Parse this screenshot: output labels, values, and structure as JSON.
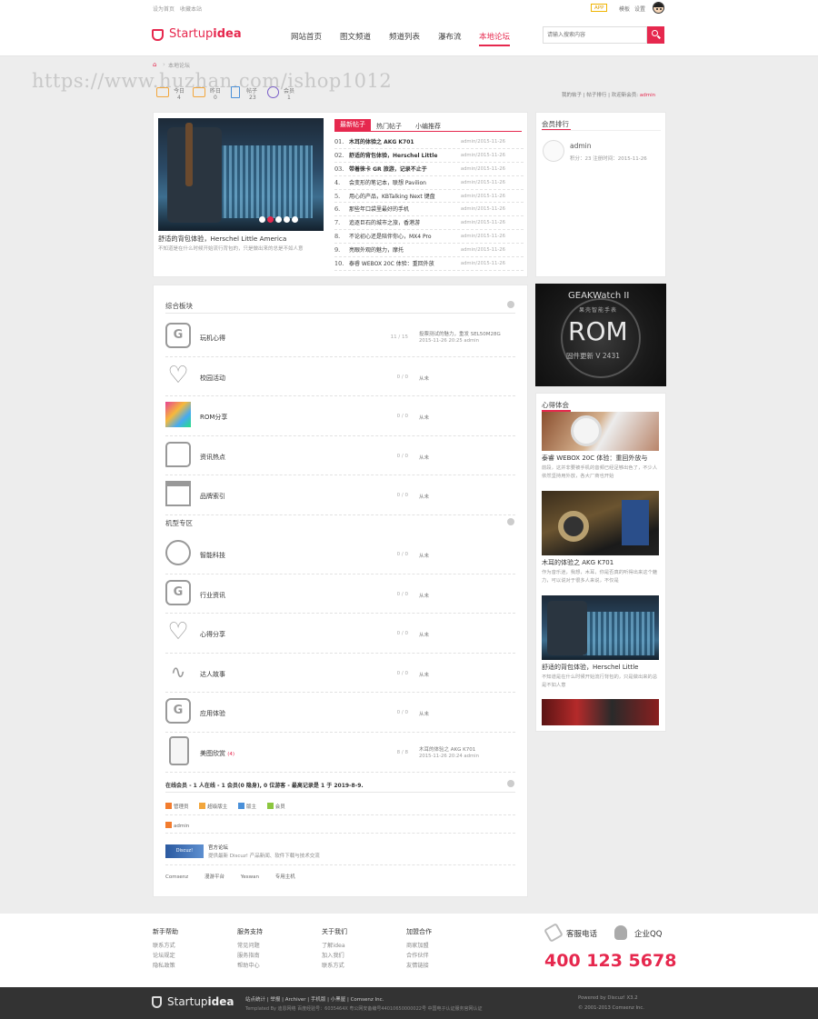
{
  "topbar": {
    "set_home": "设为首页",
    "bookmark": "收藏本站",
    "app_badge": "APP",
    "links": [
      "模板",
      "设置"
    ]
  },
  "header": {
    "logo_a": "Startup",
    "logo_b": "idea",
    "nav": [
      "网站首页",
      "图文频道",
      "频道列表",
      "瀑布流",
      "本地论坛"
    ],
    "active_nav": 4,
    "search_placeholder": "请输入搜索内容"
  },
  "watermark": "https://www.huzhan.com/ishop1012",
  "breadcrumb": "本地论坛",
  "stats": [
    {
      "label": "今日",
      "value": "4"
    },
    {
      "label": "昨日",
      "value": "0"
    },
    {
      "label": "帖子",
      "value": "23"
    },
    {
      "label": "会员",
      "value": "1"
    }
  ],
  "userlinks": {
    "a": "我的帖子",
    "b": "帖子排行",
    "c": "欢迎新会员:",
    "name": "admin"
  },
  "feature": {
    "caption": "舒适的背包体验，Herschel Little America",
    "desc": "不知道是在什么时候开始流行背包的，只是做出来的总是不如人意",
    "dots": 5
  },
  "tabs": [
    "最新帖子",
    "热门帖子",
    "小编推荐"
  ],
  "posts": [
    {
      "n": "01.",
      "t": "木耳的体验之 AKG K701",
      "m": "admin/2015-11-26"
    },
    {
      "n": "02.",
      "t": "舒适的背包体验，Herschel Little",
      "m": "admin/2015-11-26"
    },
    {
      "n": "03.",
      "t": "带着徕卡 GR 旅游，记录不止于",
      "m": "admin/2015-11-26"
    },
    {
      "n": "4.",
      "t": "会变形的笔记本，联想 Pavilion",
      "m": "admin/2015-11-26"
    },
    {
      "n": "5.",
      "t": "用心的产品，KBTalking Next 键盘",
      "m": "admin/2015-11-26"
    },
    {
      "n": "6.",
      "t": "那些年口袋里最好的手机",
      "m": "admin/2015-11-26"
    },
    {
      "n": "7.",
      "t": "追逐巨石的城市之旅，香港游",
      "m": "admin/2015-11-26"
    },
    {
      "n": "8.",
      "t": "不论初心还是陪伴你心，MX4 Pro",
      "m": "admin/2015-11-26"
    },
    {
      "n": "9.",
      "t": "亮眼外观的魅力，摩托",
      "m": "admin/2015-11-26"
    },
    {
      "n": "10.",
      "t": "泰睿 WEBOX 20C 体验：重回外放",
      "m": "admin/2015-11-26"
    }
  ],
  "members": {
    "title": "会员排行",
    "name": "admin",
    "info": "积分：23  注册时间：2015-11-26"
  },
  "cat1": {
    "title": "综合板块",
    "forums": [
      {
        "name": "玩机心得",
        "count": "11 / 15",
        "last": "投票测试的魅力，重发 SEL50M28G",
        "last2": "2015-11-26 20:25 admin",
        "icon": "g"
      },
      {
        "name": "校园活动",
        "count": "0 / 0",
        "last": "从未",
        "last2": "",
        "icon": "heart"
      },
      {
        "name": "ROM分享",
        "count": "0 / 0",
        "last": "从未",
        "last2": "",
        "icon": "img"
      },
      {
        "name": "资讯热点",
        "count": "0 / 0",
        "last": "从未",
        "last2": "",
        "icon": "chat"
      },
      {
        "name": "品牌索引",
        "count": "0 / 0",
        "last": "从未",
        "last2": "",
        "icon": "building"
      }
    ]
  },
  "cat2": {
    "title": "机型专区",
    "forums": [
      {
        "name": "智能科技",
        "count": "0 / 0",
        "last": "从未",
        "last2": "",
        "icon": "ball"
      },
      {
        "name": "行业资讯",
        "count": "0 / 0",
        "last": "从未",
        "last2": "",
        "icon": "g"
      },
      {
        "name": "心得分享",
        "count": "0 / 0",
        "last": "从未",
        "last2": "",
        "icon": "heart"
      },
      {
        "name": "达人故事",
        "count": "0 / 0",
        "last": "从未",
        "last2": "",
        "icon": "wave"
      },
      {
        "name": "应用体验",
        "count": "0 / 0",
        "last": "从未",
        "last2": "",
        "icon": "g"
      },
      {
        "name": "美图欣赏",
        "badge": "(4)",
        "count": "8 / 8",
        "last": "木耳的体验之 AKG K701",
        "last2": "2015-11-26 20:24 admin",
        "icon": "phone"
      }
    ]
  },
  "online": {
    "title": "在线会员 - 1 人在线 - 1 会员(0 隐身), 0 位游客 - 最高记录是 1 于 2019-8-9.",
    "legend": [
      "管理员",
      "超级版主",
      "版主",
      "会员"
    ],
    "user": "admin"
  },
  "official": {
    "title": "官方论坛",
    "desc": "提供最新 Discuz! 产品新闻、软件下载与技术交流",
    "img": "Discuz!"
  },
  "friends": [
    "Comsenz",
    "漫游平台",
    "Yeswan",
    "专用主机"
  ],
  "sidebar_ad": {
    "brand": "GEAKWatch II",
    "sub": "果壳智能手表",
    "big": "ROM",
    "tag": "固件更新 V 2431"
  },
  "picks": {
    "title": "心得体会",
    "items": [
      {
        "t": "泰睿 WEBOX 20C 体验：重回外放与",
        "d": "前段，这并非要被手机的音频已经足够出色了，不少人依然坚持用外放，各大厂商也开始"
      },
      {
        "t": "木耳的体验之 AKG K701",
        "d": "作为音乐迷，我想，木耳，你是否真的听得出来这个魅力，可以说对于很多人来说，不仅是"
      },
      {
        "t": "舒适的背包体验，Herschel Little",
        "d": "不知道是在什么时候开始流行背包的，只是做出来的总是不如人意"
      }
    ]
  },
  "footer": {
    "cols": [
      {
        "h": "新手帮助",
        "i": [
          "联系方式",
          "论坛规定",
          "隐私政策"
        ]
      },
      {
        "h": "服务支持",
        "i": [
          "常见问题",
          "服务指南",
          "帮助中心"
        ]
      },
      {
        "h": "关于我们",
        "i": [
          "了解idea",
          "加入我们",
          "联系方式"
        ]
      },
      {
        "h": "加盟合作",
        "i": [
          "商家加盟",
          "合作伙伴",
          "友情链接"
        ]
      }
    ],
    "service": "客服电话",
    "qq": "企业QQ",
    "phone": "400 123 5678"
  },
  "bottom": {
    "links": "站点统计 | 举报 | Archiver | 手机版 | 小黑屋 | Comsenz Inc.",
    "line2": "Templated By 迪恩网络  百度经验号：6035464X  粤公网安备编号44010650000022号  中国电子认证服务官网认证",
    "pw": "Powered by Discuz! X3.2",
    "cr": "© 2001-2013 Comsenz Inc."
  },
  "colors": {
    "accent": "#e6284e",
    "footer_bg": "#333333"
  }
}
